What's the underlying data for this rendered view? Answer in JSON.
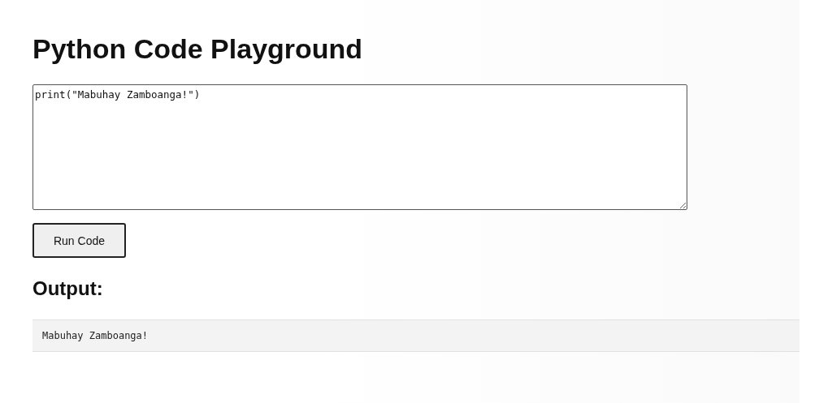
{
  "title": "Python Code Playground",
  "editor": {
    "value": "print(\"Mabuhay Zamboanga!\")"
  },
  "run_button": {
    "label": "Run Code"
  },
  "output": {
    "heading": "Output:",
    "text": "Mabuhay Zamboanga!"
  }
}
